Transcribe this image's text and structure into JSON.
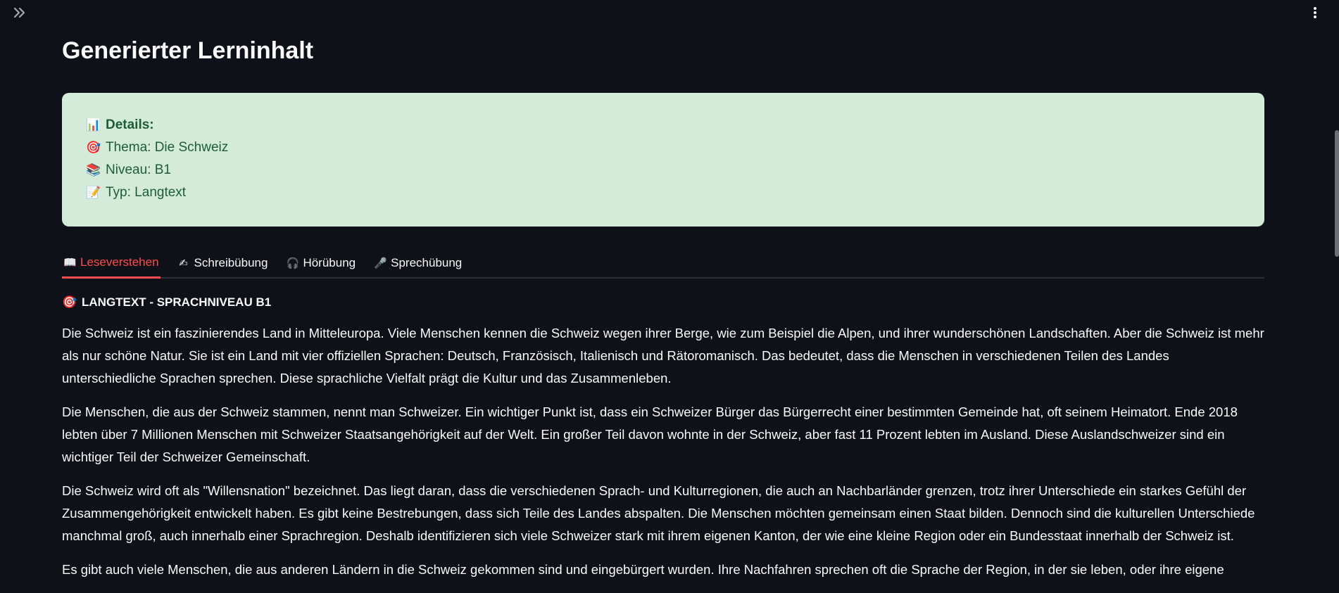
{
  "header": {
    "sidebar_toggle_icon": "double-chevron-right-icon",
    "menu_icon": "vertical-dots-icon"
  },
  "page_title": "Generierter Lerninhalt",
  "details": {
    "title": "Details:",
    "title_icon": "📊",
    "lines": [
      {
        "icon": "🎯",
        "text": "Thema: Die Schweiz"
      },
      {
        "icon": "📚",
        "text": "Niveau: B1"
      },
      {
        "icon": "📝",
        "text": "Typ: Langtext"
      }
    ],
    "background": "#d4ebda",
    "text_color": "#1b5e35"
  },
  "tabs": [
    {
      "icon": "📖",
      "label": "Leseverstehen",
      "active": true
    },
    {
      "icon": "✍",
      "label": "Schreibübung",
      "active": false
    },
    {
      "icon": "🎧",
      "label": "Hörübung",
      "active": false
    },
    {
      "icon": "🎤",
      "label": "Sprechübung",
      "active": false
    }
  ],
  "accent_color": "#ff4b4b",
  "content": {
    "heading_icon": "🎯",
    "heading": "LANGTEXT - SPRACHNIVEAU B1",
    "paragraphs": [
      "Die Schweiz ist ein faszinierendes Land in Mitteleuropa. Viele Menschen kennen die Schweiz wegen ihrer Berge, wie zum Beispiel die Alpen, und ihrer wunderschönen Landschaften. Aber die Schweiz ist mehr als nur schöne Natur. Sie ist ein Land mit vier offiziellen Sprachen: Deutsch, Französisch, Italienisch und Rätoromanisch. Das bedeutet, dass die Menschen in verschiedenen Teilen des Landes unterschiedliche Sprachen sprechen. Diese sprachliche Vielfalt prägt die Kultur und das Zusammenleben.",
      "Die Menschen, die aus der Schweiz stammen, nennt man Schweizer. Ein wichtiger Punkt ist, dass ein Schweizer Bürger das Bürgerrecht einer bestimmten Gemeinde hat, oft seinem Heimatort. Ende 2018 lebten über 7 Millionen Menschen mit Schweizer Staatsangehörigkeit auf der Welt. Ein großer Teil davon wohnte in der Schweiz, aber fast 11 Prozent lebten im Ausland. Diese Auslandschweizer sind ein wichtiger Teil der Schweizer Gemeinschaft.",
      "Die Schweiz wird oft als \"Willensnation\" bezeichnet. Das liegt daran, dass die verschiedenen Sprach- und Kulturregionen, die auch an Nachbarländer grenzen, trotz ihrer Unterschiede ein starkes Gefühl der Zusammengehörigkeit entwickelt haben. Es gibt keine Bestrebungen, dass sich Teile des Landes abspalten. Die Menschen möchten gemeinsam einen Staat bilden. Dennoch sind die kulturellen Unterschiede manchmal groß, auch innerhalb einer Sprachregion. Deshalb identifizieren sich viele Schweizer stark mit ihrem eigenen Kanton, der wie eine kleine Region oder ein Bundesstaat innerhalb der Schweiz ist.",
      "Es gibt auch viele Menschen, die aus anderen Ländern in die Schweiz gekommen sind und eingebürgert wurden. Ihre Nachfahren sprechen oft die Sprache der Region, in der sie leben, oder ihre eigene"
    ]
  }
}
